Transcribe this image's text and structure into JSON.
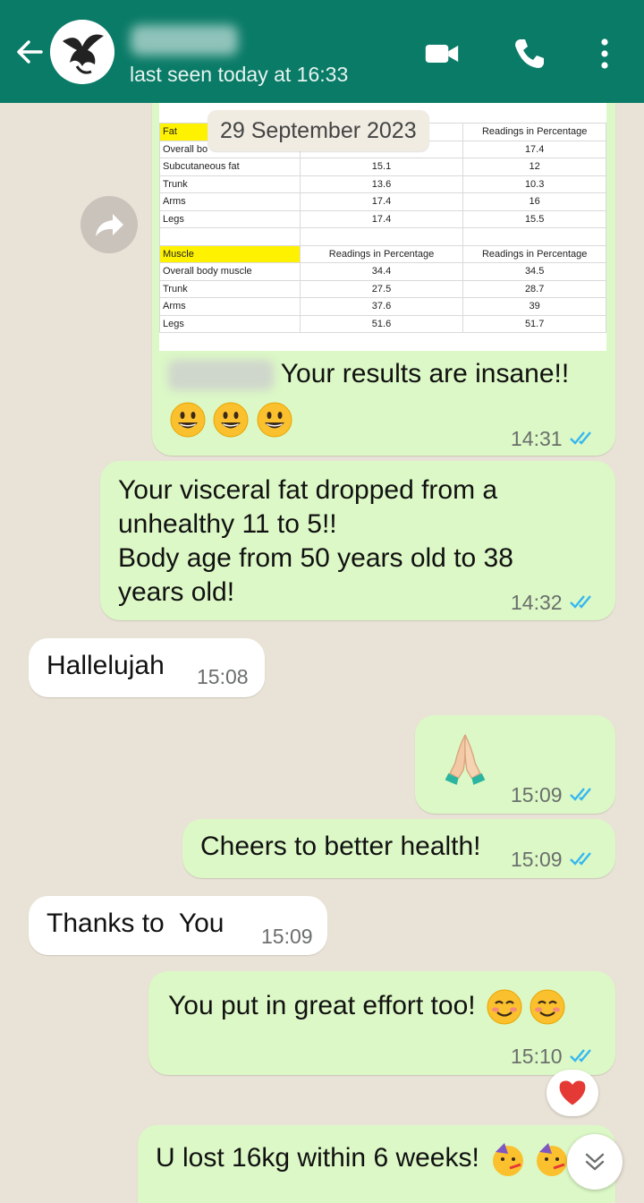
{
  "header": {
    "last_seen": "last seen today at 16:33",
    "accent": "#0a7b67"
  },
  "date_chip": "29 September 2023",
  "sheet": {
    "fat_rows": [
      [
        "Fat",
        "",
        "Readings in Percentage"
      ],
      [
        "Overall bo",
        "",
        "17.4"
      ],
      [
        "Subcutaneous fat",
        "15.1",
        "12"
      ],
      [
        "Trunk",
        "13.6",
        "10.3"
      ],
      [
        "Arms",
        "17.4",
        "16"
      ],
      [
        "Legs",
        "17.4",
        "15.5"
      ]
    ],
    "muscle_rows": [
      [
        "Muscle",
        "Readings in Percentage",
        "Readings in Percentage"
      ],
      [
        "Overall body muscle",
        "34.4",
        "34.5"
      ],
      [
        "Trunk",
        "27.5",
        "28.7"
      ],
      [
        "Arms",
        "37.6",
        "39"
      ],
      [
        "Legs",
        "51.6",
        "51.7"
      ]
    ]
  },
  "messages": [
    {
      "text": "Your results are insane!!",
      "time": "14:31",
      "emojis": [
        "grinning-face",
        "grinning-face",
        "grinning-face"
      ]
    },
    {
      "text_lines": [
        "Your visceral fat dropped from a",
        "unhealthy 11 to 5!!",
        "Body age from 50 years old to 38",
        "years old!"
      ],
      "time": "14:32"
    },
    {
      "text": "Hallelujah",
      "time": "15:08"
    },
    {
      "emoji": "folded-hands",
      "time": "15:09"
    },
    {
      "text": "Cheers to better health!",
      "time": "15:09"
    },
    {
      "text": "Thanks to  You",
      "time": "15:09"
    },
    {
      "text": "You put in great effort too!",
      "time": "15:10",
      "emojis": [
        "smiling-face",
        "smiling-face"
      ],
      "reaction": "red-heart"
    },
    {
      "text": "U lost 16kg within 6 weeks!",
      "emojis": [
        "partying-face",
        "partying-face"
      ]
    }
  ]
}
